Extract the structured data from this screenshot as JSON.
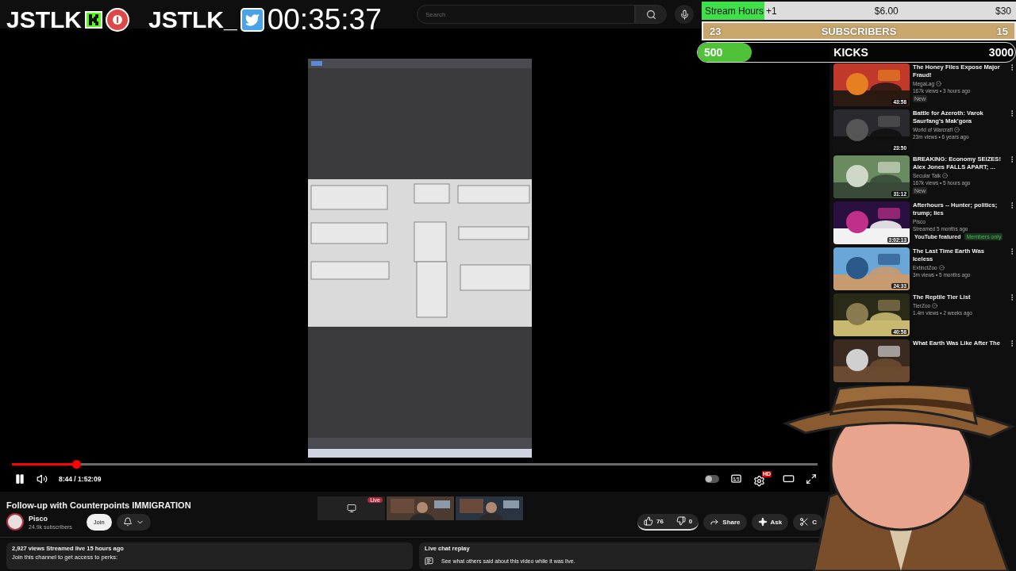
{
  "overlay": {
    "logos": [
      {
        "text": "JSTLK",
        "kind": "kick"
      },
      {
        "text": "JSTLK_",
        "kind": "twitter"
      }
    ],
    "timer": "00:35:37",
    "stream_hours": {
      "label": "Stream Hours",
      "increment": "+1",
      "current": "$6.00",
      "target": "$30",
      "level": 0.2
    },
    "subscribers": {
      "current": "23",
      "label": "SUBSCRIBERS",
      "target": "15"
    },
    "kicks": {
      "current": "500",
      "label": "KICKS",
      "target": "3000",
      "level": 0.17
    }
  },
  "search": {
    "placeholder": "Search"
  },
  "player": {
    "playing": true,
    "autoplay": false,
    "level": 0.08,
    "time": "8:44 / 1:52:09",
    "live_badge": "Live",
    "settings_badge": "HD"
  },
  "video": {
    "title": "Follow-up with Counterpoints IMMIGRATION",
    "channel": "Pisco",
    "subscribers": "24.9k subscribers",
    "join": "Join",
    "actions": [
      {
        "kind": "like",
        "label": "76"
      },
      {
        "kind": "dislike",
        "label": "0"
      },
      {
        "kind": "share",
        "label": "Share"
      },
      {
        "kind": "ask",
        "label": "Ask"
      },
      {
        "kind": "clip",
        "label": "C"
      }
    ]
  },
  "description": {
    "stats": "2,927 views  Streamed live 15 hours ago",
    "text": "Join this channel to get access to perks:"
  },
  "live_chat": {
    "title": "Live chat replay",
    "text": "See what others said about this video while it was live."
  },
  "sidebar": [
    {
      "title": "The Honey Files Expose Major Fraud!",
      "channel": "MegaLag",
      "verified": true,
      "meta": "167k views • 3 hours ago",
      "duration": "43:58",
      "badges": [
        {
          "kind": "plain",
          "label": "New"
        }
      ]
    },
    {
      "title": "Battle for Azeroth: Varok Saurfang's Mak'gora",
      "channel": "World of Warcraft",
      "verified": true,
      "meta": "23m views • 6 years ago",
      "duration": "23:50"
    },
    {
      "title": "BREAKING: Economy SEIZES! Alex Jones  FALLS APART; ...",
      "channel": "Secular Talk",
      "verified": true,
      "meta": "167k views • 5 hours ago",
      "duration": "31:12",
      "badges": [
        {
          "kind": "plain",
          "label": "New"
        }
      ]
    },
    {
      "title": "Afterhours -- Hunter; politics; trump; lies",
      "channel": "Pisco",
      "verified": false,
      "meta": "Streamed 5 months ago",
      "duration": "3:02:13",
      "badges": [
        {
          "kind": "featured",
          "label": "YouTube featured"
        },
        {
          "kind": "members",
          "label": "Members only"
        }
      ]
    },
    {
      "title": "The Last Time Earth Was Iceless",
      "channel": "ExtinctZoo",
      "verified": true,
      "meta": "3m views • 5 months ago",
      "duration": "24:33"
    },
    {
      "title": "The Reptile Tier List",
      "channel": "TierZoo",
      "verified": true,
      "meta": "1.4m views • 2 weeks ago",
      "duration": "40:58"
    },
    {
      "title": "What Earth Was Like After The"
    }
  ]
}
